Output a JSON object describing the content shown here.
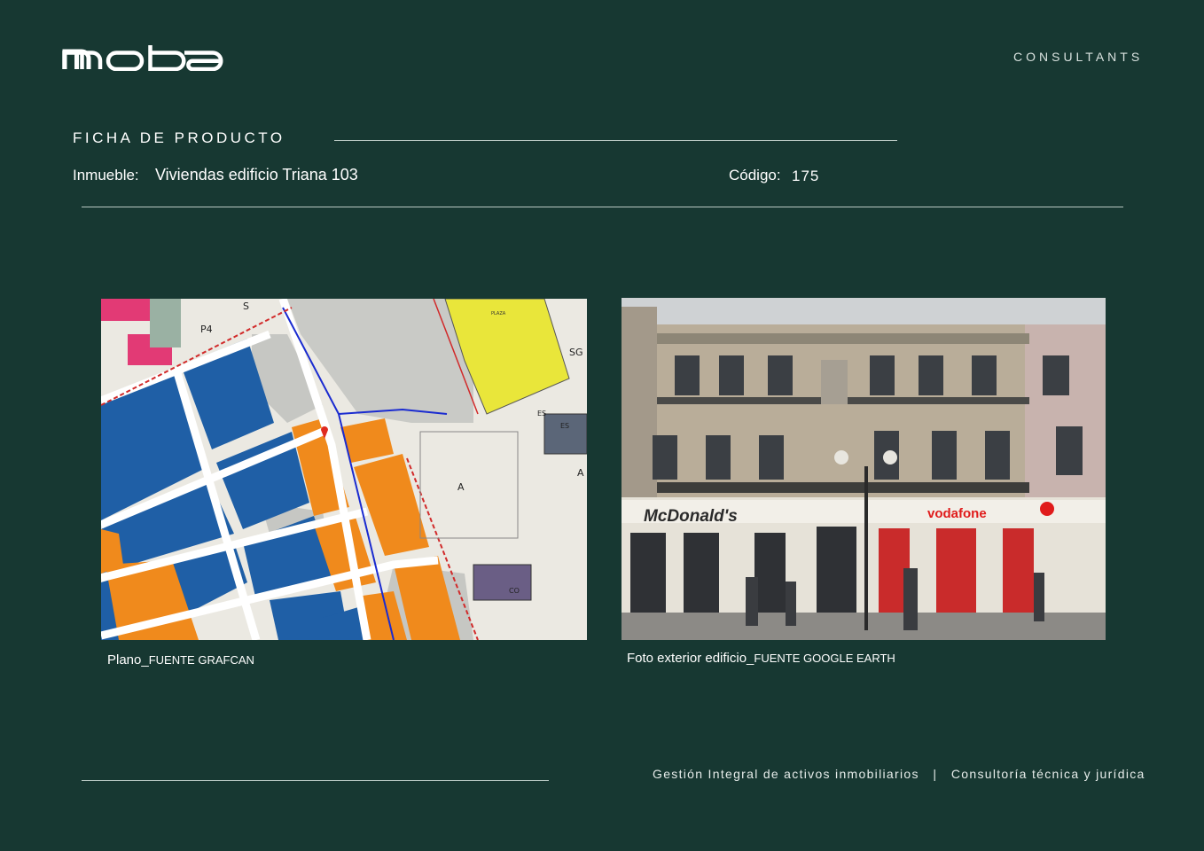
{
  "brand": {
    "logo_text": "moba",
    "tagline": "CONSULTANTS"
  },
  "header": {
    "section_title": "FICHA DE PRODUCTO",
    "property_label": "Inmueble:",
    "property_value": "Viviendas edificio Triana 103",
    "code_label": "Código:",
    "code_value": "175"
  },
  "figures": [
    {
      "kind": "map",
      "caption_main": "Plano_",
      "caption_source": "FUENTE GRAFCAN",
      "map_labels": [
        "S",
        "P4",
        "SG",
        "ES",
        "ES",
        "A",
        "A",
        "CO"
      ]
    },
    {
      "kind": "photo",
      "caption_main": "Foto exterior edificio_",
      "caption_source": "FUENTE GOOGLE EARTH",
      "signage": [
        "McDonald's",
        "vodafone"
      ]
    }
  ],
  "footer": {
    "services_left": "Gestión Integral de activos inmobiliarios",
    "separator": "|",
    "services_right": "Consultoría técnica y jurídica"
  },
  "colors": {
    "background": "#173832",
    "map_orange": "#f08a1c",
    "map_blue": "#1f5fa6",
    "map_yellow": "#e9e63a"
  }
}
